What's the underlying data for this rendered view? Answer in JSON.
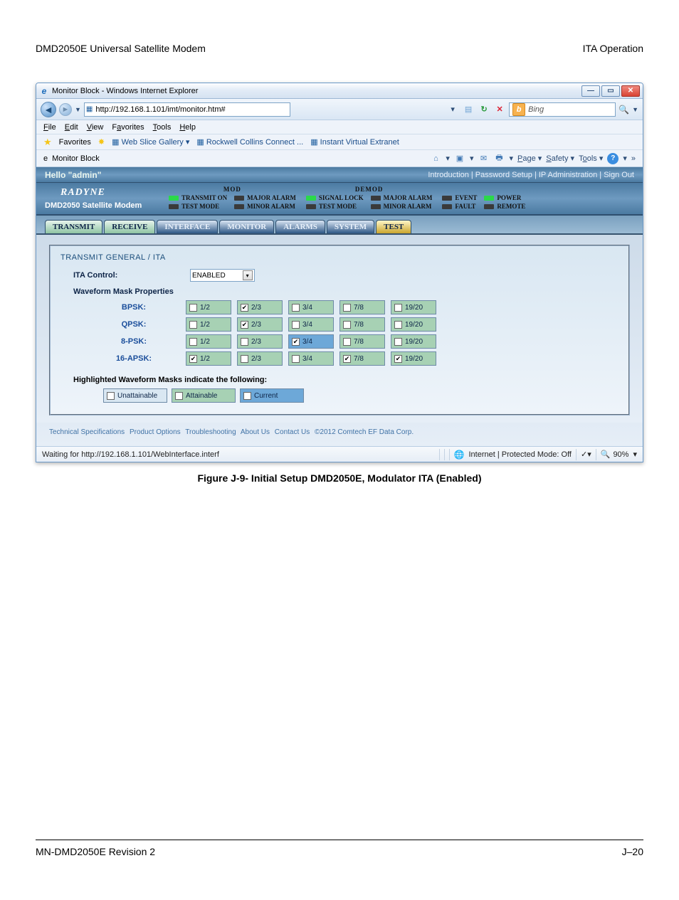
{
  "page": {
    "header_left": "DMD2050E Universal Satellite Modem",
    "header_right": "ITA Operation",
    "footer_left": "MN-DMD2050E   Revision 2",
    "footer_right": "J–20",
    "figure_caption": "Figure J-9- Initial Setup DMD2050E, Modulator ITA (Enabled)"
  },
  "browser": {
    "window_title": "Monitor Block - Windows Internet Explorer",
    "url": "http://192.168.1.101/imt/monitor.htm#",
    "search_placeholder": "Bing",
    "menus": {
      "file": "File",
      "edit": "Edit",
      "view": "View",
      "favorites": "Favorites",
      "tools": "Tools",
      "help": "Help"
    },
    "favbar": {
      "label": "Favorites",
      "link1": "Web Slice Gallery",
      "link2": "Rockwell Collins Connect ...",
      "link3": "Instant Virtual Extranet"
    },
    "cmdbar": {
      "tab_label": "Monitor Block",
      "page": "Page",
      "safety": "Safety",
      "tools": "Tools"
    },
    "statusbar": {
      "left": "Waiting for http://192.168.1.101/WebInterface.interf",
      "zone": "Internet | Protected Mode: Off",
      "zoom": "90%"
    }
  },
  "app": {
    "hello": "Hello \"admin\"",
    "navlinks": "Introduction  |  Password Setup  |  IP Administration  |  Sign Out",
    "brand_line1": "RADYNE",
    "brand_line2": "DMD2050 Satellite Modem",
    "leds": {
      "mod_title": "MOD",
      "demod_title": "DEMOD",
      "transmit_on": "TRANSMIT ON",
      "test_mode": "TEST MODE",
      "major": "MAJOR ALARM",
      "minor": "MINOR ALARM",
      "signal_lock": "SIGNAL LOCK",
      "event": "EVENT",
      "fault": "FAULT",
      "power": "POWER",
      "remote": "REMOTE"
    },
    "tabs": {
      "transmit": "TRANSMIT",
      "receive": "RECEIVE",
      "interface": "INTERFACE",
      "monitor": "MONITOR",
      "alarms": "ALARMS",
      "system": "SYSTEM",
      "test": "TEST"
    },
    "panel": {
      "title": "TRANSMIT GENERAL / ITA",
      "ita_label": "ITA Control:",
      "ita_value": "ENABLED",
      "subhead": "Waveform Mask Properties",
      "rows": {
        "bpsk": {
          "label": "BPSK:",
          "c0": "1/2",
          "c1": "2/3",
          "c2": "3/4",
          "c3": "7/8",
          "c4": "19/20",
          "chk": [
            false,
            true,
            false,
            false,
            false
          ],
          "cur": []
        },
        "qpsk": {
          "label": "QPSK:",
          "c0": "1/2",
          "c1": "2/3",
          "c2": "3/4",
          "c3": "7/8",
          "c4": "19/20",
          "chk": [
            false,
            true,
            false,
            false,
            false
          ],
          "cur": []
        },
        "psk8": {
          "label": "8-PSK:",
          "c0": "1/2",
          "c1": "2/3",
          "c2": "3/4",
          "c3": "7/8",
          "c4": "19/20",
          "chk": [
            false,
            false,
            true,
            false,
            false
          ],
          "cur": [
            2
          ]
        },
        "apsk16": {
          "label": "16-APSK:",
          "c0": "1/2",
          "c1": "2/3",
          "c2": "3/4",
          "c3": "7/8",
          "c4": "19/20",
          "chk": [
            true,
            false,
            false,
            true,
            true
          ],
          "cur": []
        }
      },
      "legend_note": "Highlighted Waveform Masks indicate the following:",
      "legend": {
        "un": "Unattainable",
        "att": "Attainable",
        "cur": "Current"
      }
    },
    "footer_links": {
      "a": "Technical Specifications",
      "b": "Product Options",
      "c": "Troubleshooting",
      "d": "About Us",
      "e": "Contact Us",
      "f": "©2012 Comtech EF Data Corp."
    }
  }
}
